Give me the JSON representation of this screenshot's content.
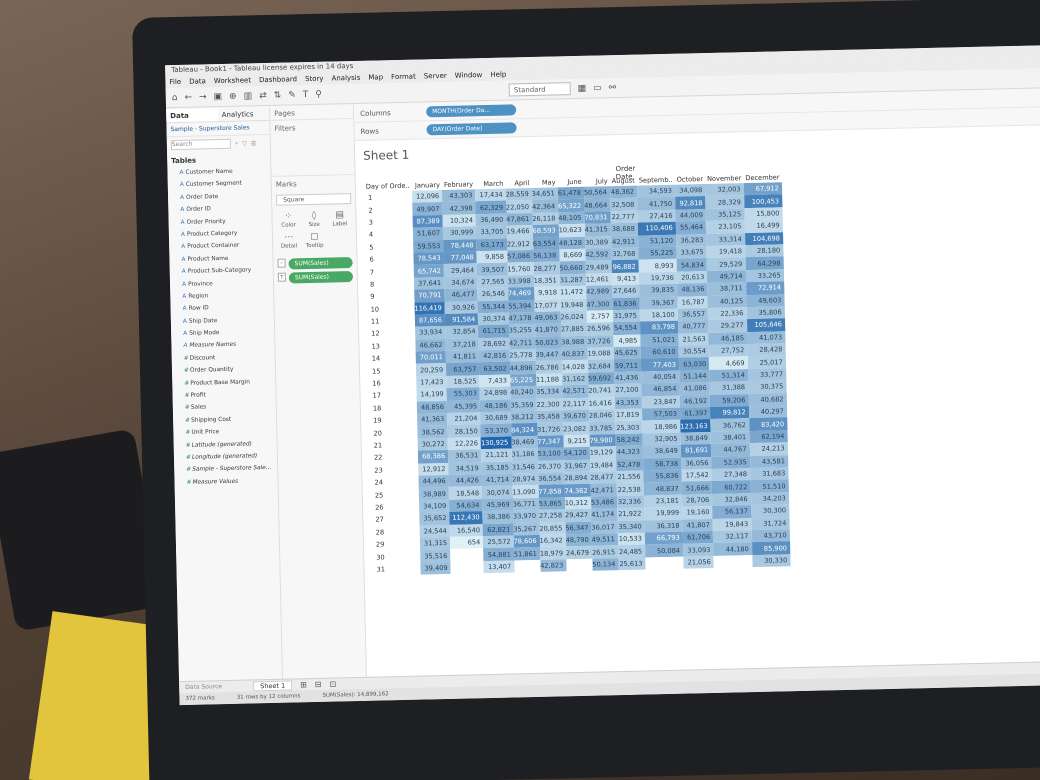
{
  "window": {
    "title": "Tableau - Book1 - Tableau license expires in 14 days"
  },
  "menu": [
    "File",
    "Data",
    "Worksheet",
    "Dashboard",
    "Story",
    "Analysis",
    "Map",
    "Format",
    "Server",
    "Window",
    "Help"
  ],
  "toolbar": {
    "fit": "Standard"
  },
  "data_pane": {
    "tabs": [
      "Data",
      "Analytics"
    ],
    "source": "Sample - Superstore Sales",
    "search_placeholder": "Search",
    "tables_label": "Tables",
    "fields": [
      {
        "name": "Customer Name",
        "kind": "dim"
      },
      {
        "name": "Customer Segment",
        "kind": "dim"
      },
      {
        "name": "Order Date",
        "kind": "dim"
      },
      {
        "name": "Order ID",
        "kind": "dim"
      },
      {
        "name": "Order Priority",
        "kind": "dim"
      },
      {
        "name": "Product Category",
        "kind": "dim"
      },
      {
        "name": "Product Container",
        "kind": "dim"
      },
      {
        "name": "Product Name",
        "kind": "dim"
      },
      {
        "name": "Product Sub-Category",
        "kind": "dim"
      },
      {
        "name": "Province",
        "kind": "dim"
      },
      {
        "name": "Region",
        "kind": "dim"
      },
      {
        "name": "Row ID",
        "kind": "dim"
      },
      {
        "name": "Ship Date",
        "kind": "dim"
      },
      {
        "name": "Ship Mode",
        "kind": "dim"
      },
      {
        "name": "Measure Names",
        "kind": "dim",
        "italic": true
      },
      {
        "name": "Discount",
        "kind": "measure"
      },
      {
        "name": "Order Quantity",
        "kind": "measure"
      },
      {
        "name": "Product Base Margin",
        "kind": "measure"
      },
      {
        "name": "Profit",
        "kind": "measure"
      },
      {
        "name": "Sales",
        "kind": "measure"
      },
      {
        "name": "Shipping Cost",
        "kind": "measure"
      },
      {
        "name": "Unit Price",
        "kind": "measure"
      },
      {
        "name": "Latitude (generated)",
        "kind": "measure",
        "italic": true
      },
      {
        "name": "Longitude (generated)",
        "kind": "measure",
        "italic": true
      },
      {
        "name": "Sample - Superstore Sale...",
        "kind": "measure",
        "italic": true
      },
      {
        "name": "Measure Values",
        "kind": "measure",
        "italic": true
      }
    ]
  },
  "shelves": {
    "pages": "Pages",
    "filters": "Filters",
    "marks": "Marks",
    "mark_type": "Square",
    "mark_buttons": [
      "Color",
      "Size",
      "Label",
      "Detail",
      "Tooltip"
    ],
    "mark_pills": [
      "SUM(Sales)",
      "SUM(Sales)"
    ],
    "columns_label": "Columns",
    "rows_label": "Rows",
    "columns_pill": "MONTH(Order Da...",
    "rows_pill": "DAY(Order Date)"
  },
  "sheet": {
    "title": "Sheet 1",
    "col_group": "Order Date",
    "row_header": "Day of Orde..",
    "months": [
      "January",
      "February",
      "March",
      "April",
      "May",
      "June",
      "July",
      "August",
      "Septemb..",
      "October",
      "November",
      "December"
    ]
  },
  "chart_data": {
    "type": "heatmap",
    "rows": [
      [
        "12,096",
        "43,303",
        "17,434",
        "28,559",
        "34,651",
        "61,478",
        "50,564",
        "48,362",
        "34,593",
        "34,098",
        "32,003",
        "67,912"
      ],
      [
        "49,907",
        "42,398",
        "62,329",
        "22,050",
        "42,364",
        "65,322",
        "48,664",
        "32,508",
        "41,750",
        "92,818",
        "28,329",
        "100,453"
      ],
      [
        "87,389",
        "10,324",
        "36,490",
        "47,861",
        "26,118",
        "48,105",
        "70,831",
        "22,777",
        "27,416",
        "44,009",
        "35,125",
        "15,800"
      ],
      [
        "51,607",
        "30,999",
        "33,705",
        "19,466",
        "68,593",
        "10,623",
        "41,315",
        "38,688",
        "110,406",
        "55,464",
        "23,105",
        "16,499"
      ],
      [
        "59,553",
        "78,448",
        "63,173",
        "22,912",
        "63,554",
        "48,128",
        "30,389",
        "42,911",
        "51,120",
        "36,283",
        "33,314",
        "104,698"
      ],
      [
        "78,543",
        "77,048",
        "9,858",
        "57,086",
        "56,138",
        "8,669",
        "42,592",
        "32,768",
        "55,225",
        "33,675",
        "19,418",
        "28,180"
      ],
      [
        "65,742",
        "29,464",
        "39,507",
        "15,760",
        "28,277",
        "50,660",
        "29,489",
        "96,882",
        "8,993",
        "54,834",
        "29,529",
        "64,298"
      ],
      [
        "37,641",
        "34,674",
        "27,565",
        "33,998",
        "18,351",
        "31,287",
        "12,461",
        "9,413",
        "19,736",
        "20,613",
        "49,714",
        "33,265"
      ],
      [
        "70,791",
        "46,477",
        "26,546",
        "74,469",
        "9,918",
        "11,472",
        "42,989",
        "27,646",
        "39,835",
        "48,136",
        "38,711",
        "72,914"
      ],
      [
        "116,419",
        "30,926",
        "55,344",
        "55,394",
        "17,077",
        "19,948",
        "47,300",
        "61,836",
        "39,367",
        "16,787",
        "40,125",
        "49,603"
      ],
      [
        "87,656",
        "91,584",
        "30,374",
        "47,178",
        "49,063",
        "26,024",
        "2,757",
        "31,975",
        "18,100",
        "36,557",
        "22,336",
        "35,806"
      ],
      [
        "33,934",
        "32,854",
        "61,715",
        "35,255",
        "41,870",
        "27,885",
        "26,596",
        "54,554",
        "83,798",
        "40,777",
        "29,277",
        "105,646"
      ],
      [
        "46,662",
        "37,218",
        "28,692",
        "42,711",
        "50,023",
        "38,988",
        "37,726",
        "4,985",
        "51,021",
        "21,563",
        "46,185",
        "41,073"
      ],
      [
        "70,011",
        "41,811",
        "42,816",
        "25,778",
        "39,447",
        "40,837",
        "19,088",
        "45,625",
        "60,610",
        "30,554",
        "27,752",
        "28,428"
      ],
      [
        "20,259",
        "63,757",
        "63,502",
        "44,896",
        "26,786",
        "14,028",
        "32,684",
        "59,711",
        "77,403",
        "63,030",
        "4,669",
        "25,017"
      ],
      [
        "17,423",
        "18,525",
        "7,433",
        "65,225",
        "11,188",
        "31,162",
        "59,692",
        "41,436",
        "40,054",
        "51,144",
        "51,314",
        "33,777"
      ],
      [
        "14,199",
        "55,303",
        "24,898",
        "40,240",
        "35,334",
        "42,571",
        "20,741",
        "27,100",
        "46,854",
        "41,086",
        "31,388",
        "30,375"
      ],
      [
        "48,856",
        "45,395",
        "48,186",
        "35,359",
        "22,300",
        "22,117",
        "16,416",
        "43,353",
        "23,847",
        "46,192",
        "59,206",
        "40,682"
      ],
      [
        "41,363",
        "21,204",
        "30,689",
        "38,212",
        "35,458",
        "39,670",
        "28,046",
        "17,819",
        "57,503",
        "61,397",
        "99,812",
        "40,297"
      ],
      [
        "38,562",
        "28,150",
        "53,370",
        "84,324",
        "31,726",
        "23,082",
        "33,785",
        "25,303",
        "18,986",
        "123,163",
        "36,762",
        "83,420"
      ],
      [
        "30,272",
        "12,226",
        "130,925",
        "38,469",
        "77,347",
        "9,215",
        "79,980",
        "58,242",
        "32,905",
        "38,849",
        "38,401",
        "62,194"
      ],
      [
        "68,386",
        "36,531",
        "21,121",
        "31,186",
        "53,100",
        "54,120",
        "19,129",
        "44,323",
        "38,649",
        "81,691",
        "44,767",
        "24,213"
      ],
      [
        "12,912",
        "34,519",
        "35,185",
        "31,546",
        "26,370",
        "31,967",
        "19,484",
        "52,478",
        "58,738",
        "36,056",
        "52,935",
        "43,581"
      ],
      [
        "44,496",
        "44,426",
        "41,714",
        "28,974",
        "36,554",
        "28,894",
        "28,477",
        "21,556",
        "55,836",
        "17,542",
        "27,348",
        "31,683"
      ],
      [
        "38,989",
        "18,548",
        "30,074",
        "13,090",
        "77,858",
        "74,362",
        "42,471",
        "22,538",
        "48,837",
        "51,666",
        "60,722",
        "51,510"
      ],
      [
        "34,109",
        "54,634",
        "45,969",
        "36,771",
        "53,865",
        "10,312",
        "53,486",
        "32,336",
        "23,181",
        "28,706",
        "32,846",
        "34,203"
      ],
      [
        "35,652",
        "112,430",
        "38,386",
        "33,970",
        "27,258",
        "29,427",
        "41,174",
        "21,922",
        "19,999",
        "19,160",
        "56,137",
        "30,300"
      ],
      [
        "24,544",
        "16,540",
        "62,821",
        "35,267",
        "20,855",
        "56,347",
        "36,017",
        "35,340",
        "36,318",
        "41,807",
        "19,843",
        "31,724"
      ],
      [
        "31,315",
        "654",
        "25,572",
        "78,606",
        "16,342",
        "48,790",
        "49,511",
        "10,533",
        "66,793",
        "61,706",
        "32,117",
        "43,710"
      ],
      [
        "35,516",
        "",
        "54,881",
        "51,861",
        "18,979",
        "24,679",
        "26,915",
        "24,485",
        "50,084",
        "33,093",
        "44,180",
        "85,900"
      ],
      [
        "39,409",
        "",
        "13,407",
        "",
        "42,823",
        "",
        "50,134",
        "25,613",
        "",
        "21,056",
        "",
        "30,330"
      ]
    ],
    "color_low": "#dff0f6",
    "color_high": "#2166ac"
  },
  "status": {
    "datasource_tab": "Data Source",
    "sheet_tab": "Sheet 1",
    "marks": "372 marks",
    "rows_cols": "31 rows by 12 columns",
    "sum": "SUM(Sales): 14,899,162"
  }
}
